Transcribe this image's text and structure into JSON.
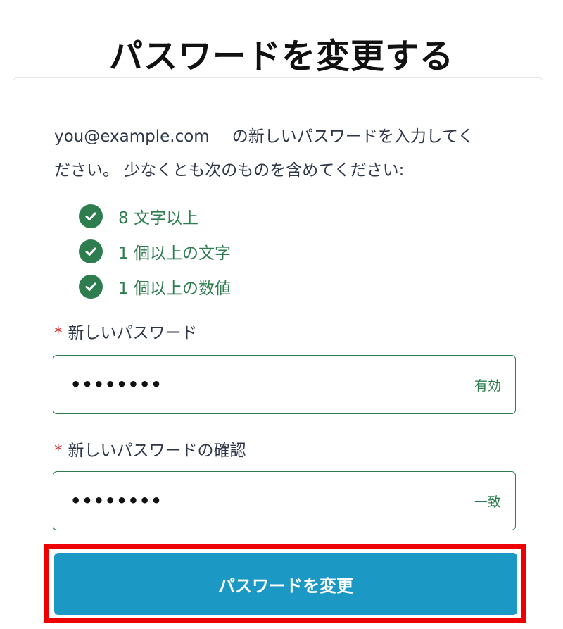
{
  "page": {
    "title": "パスワードを変更する"
  },
  "intro": {
    "email": "you@example.com",
    "text_line1": "の新しいパスワードを入力してく",
    "text_line2": "ださい。 少なくとも次のものを含めてください:"
  },
  "rules": [
    {
      "label": "8 文字以上",
      "met": true
    },
    {
      "label": "1 個以上の文字",
      "met": true
    },
    {
      "label": "1 個以上の数値",
      "met": true
    }
  ],
  "fields": {
    "required_marker": "*",
    "new_password": {
      "label": "新しいパスワード",
      "value": "••••••••",
      "status": "有効"
    },
    "confirm_password": {
      "label": "新しいパスワードの確認",
      "value": "••••••••",
      "status": "一致"
    }
  },
  "submit": {
    "label": "パスワードを変更"
  },
  "colors": {
    "accent": "#1b98c4",
    "success": "#2e7d4f",
    "required": "#d32f2f",
    "highlight": "#ee0000"
  }
}
